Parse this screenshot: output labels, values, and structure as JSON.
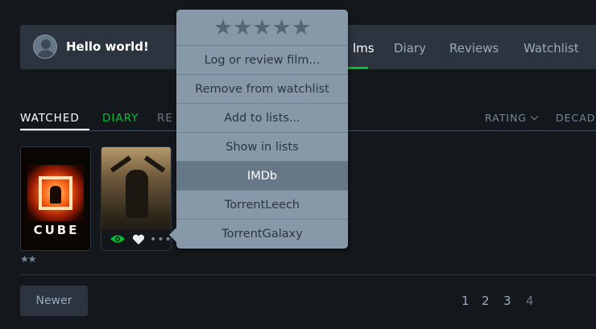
{
  "profile": {
    "greeting": "Hello world!"
  },
  "nav": {
    "films": "lms",
    "diary": "Diary",
    "reviews": "Reviews",
    "watchlist": "Watchlist"
  },
  "subtabs": {
    "watched": "WATCHED",
    "diary": "DIARY",
    "reviews": "RE"
  },
  "sort": {
    "rating": "RATING",
    "decade": "DECAD"
  },
  "posters": [
    {
      "title": "CUBE",
      "rating": "★★"
    },
    {
      "title": ""
    }
  ],
  "popup": {
    "stars": "★★★★★",
    "items": [
      "Log or review film...",
      "Remove from watchlist",
      "Add to lists...",
      "Show in lists",
      "IMDb",
      "TorrentLeech",
      "TorrentGalaxy"
    ]
  },
  "pagination": {
    "newer": "Newer",
    "pages": [
      "1",
      "2",
      "3",
      "4"
    ]
  },
  "colors": {
    "accent": "#00c030",
    "background": "#14181c",
    "popup": "#8799a9",
    "active_item": "#667788"
  }
}
